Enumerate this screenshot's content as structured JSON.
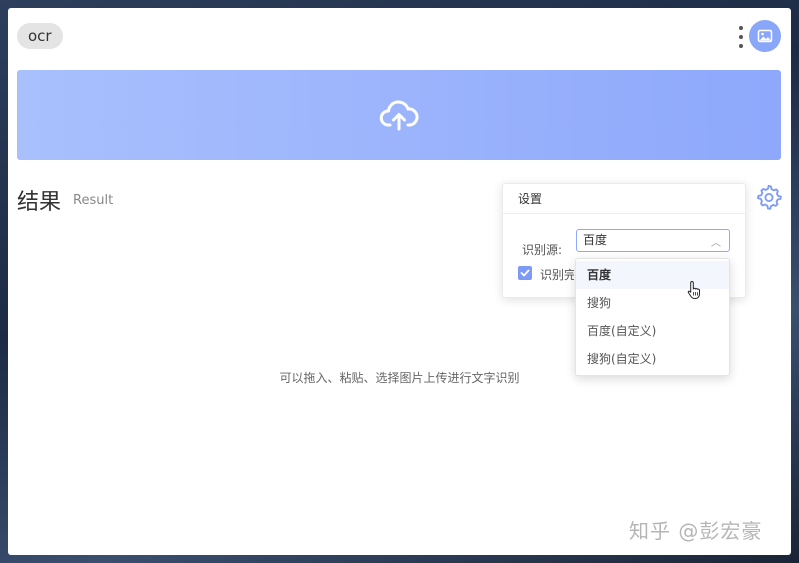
{
  "header": {
    "tag_label": "ocr"
  },
  "upload": {
    "icon": "cloud-upload-icon"
  },
  "result": {
    "title": "结果",
    "subtitle": "Result",
    "empty_hint": "可以拖入、粘贴、选择图片上传进行文字识别"
  },
  "settings": {
    "title": "设置",
    "source_label": "识别源:",
    "source_value": "百度",
    "checkbox_label": "识别完",
    "checkbox_checked": true,
    "options": [
      {
        "label": "百度",
        "selected": true
      },
      {
        "label": "搜狗"
      },
      {
        "label": "百度(自定义)"
      },
      {
        "label": "搜狗(自定义)"
      }
    ]
  },
  "watermark": "知乎 @彭宏豪",
  "colors": {
    "accent": "#8ea8fb",
    "upload_start": "#a9c0fd",
    "upload_end": "#8ea8fb",
    "avatar": "#8aa6f8"
  }
}
